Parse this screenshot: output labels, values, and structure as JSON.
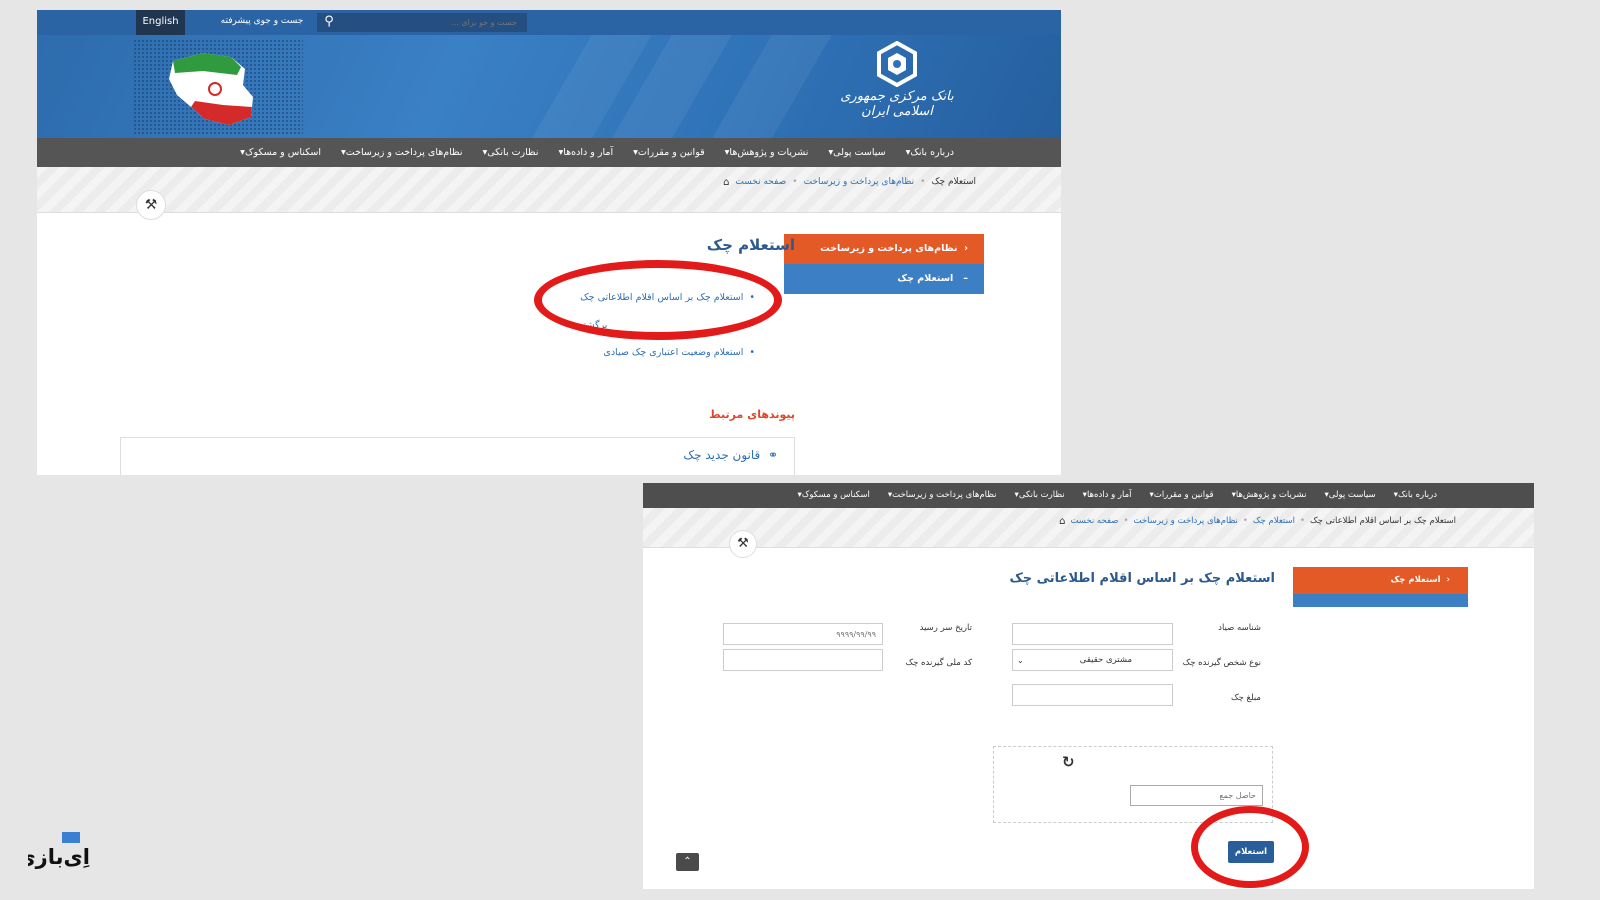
{
  "top": {
    "english_label": "English",
    "advanced_search": "جست و جوی پیشرفته",
    "search_placeholder": "جست و جو برای ...",
    "logo_text": "بانک مرکزی جمهوری اسلامی ایران",
    "nav": [
      "درباره بانک",
      "سیاست پولی",
      "نشریات و پژوهش‌ها",
      "قوانین و مقررات",
      "آمار و داده‌ها",
      "نظارت بانکی",
      "نظام‌های پرداخت و زیرساخت",
      "اسکناس و مسکوک"
    ],
    "breadcrumb": {
      "home": "صفحه نخست",
      "parent": "نظام‌های پرداخت و زیرساخت",
      "current": "استعلام چک"
    },
    "side_head": "نظام‌های پرداخت و زیرساخت",
    "side_item": "استعلام چک",
    "title": "استعلام چک",
    "list": [
      "استعلام چک بر اساس اقلام اطلاعاتی چک",
      "برگشتی",
      "استعلام وضعیت اعتباری چک صیادی"
    ],
    "related_title": "پیوندهای مرتبط",
    "related_link": "قانون جدید چک"
  },
  "bottom": {
    "nav": [
      "درباره بانک",
      "سیاست پولی",
      "نشریات و پژوهش‌ها",
      "قوانین و مقررات",
      "آمار و داده‌ها",
      "نظارت بانکی",
      "نظام‌های پرداخت و زیرساخت",
      "اسکناس و مسکوک"
    ],
    "breadcrumb": {
      "home": "صفحه نخست",
      "parent": "نظام‌های پرداخت و زیرساخت",
      "mid": "استعلام چک",
      "current": "استعلام چک بر اساس اقلام اطلاعاتی چک"
    },
    "side_head": "استعلام چک",
    "title": "استعلام چک بر اساس اقلام اطلاعاتی چک",
    "labels": {
      "sayad_id": "شناسه صیاد",
      "due_date": "تاریخ سر رسید",
      "receiver_type": "نوع شخص گیرنده چک",
      "national_code": "کد ملی گیرنده چک",
      "amount": "مبلغ چک"
    },
    "due_date_placeholder": "۹۹۹۹/۹۹/۹۹",
    "receiver_type_value": "مشتری حقیقی",
    "sum_placeholder": "حاصل جمع",
    "submit": "استعلام"
  },
  "watermark": "اِی‌بازی",
  "colors": {
    "blue": "#2a64a4",
    "orange": "#e35a27",
    "highlight": "#e21a1a"
  }
}
